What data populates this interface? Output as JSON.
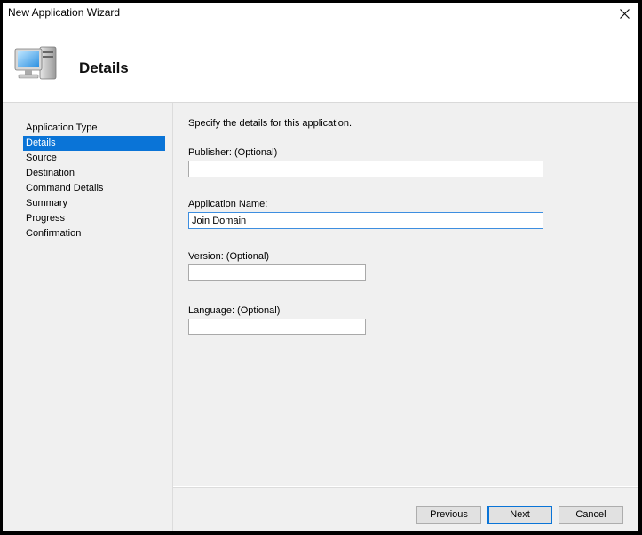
{
  "window": {
    "title": "New Application Wizard",
    "close_glyph": "✕"
  },
  "header": {
    "title": "Details",
    "icon": "computer-icon"
  },
  "nav": {
    "items": [
      {
        "label": "Application Type",
        "selected": false
      },
      {
        "label": "Details",
        "selected": true
      },
      {
        "label": "Source",
        "selected": false
      },
      {
        "label": "Destination",
        "selected": false
      },
      {
        "label": "Command Details",
        "selected": false
      },
      {
        "label": "Summary",
        "selected": false
      },
      {
        "label": "Progress",
        "selected": false
      },
      {
        "label": "Confirmation",
        "selected": false
      }
    ]
  },
  "form": {
    "intro": "Specify the details for this application.",
    "publisher": {
      "label": "Publisher: (Optional)",
      "value": ""
    },
    "app_name": {
      "label": "Application Name:",
      "value": "Join Domain"
    },
    "version": {
      "label": "Version: (Optional)",
      "value": ""
    },
    "language": {
      "label": "Language: (Optional)",
      "value": ""
    }
  },
  "buttons": {
    "previous": "Previous",
    "next": "Next",
    "cancel": "Cancel"
  },
  "colors": {
    "selection": "#0a74d7",
    "panel": "#f0f0f0"
  }
}
